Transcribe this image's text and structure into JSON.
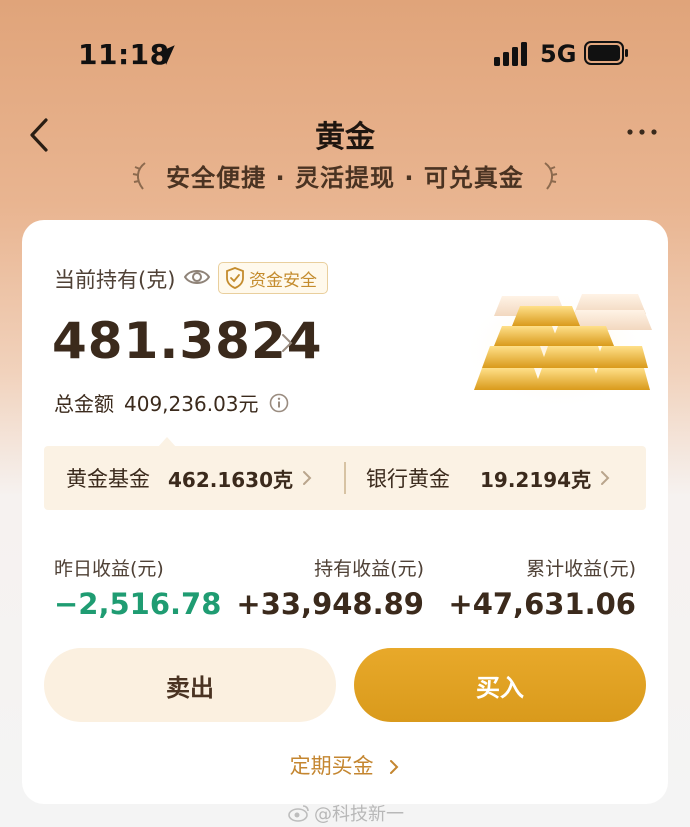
{
  "status_bar": {
    "time": "11:18",
    "network": "5G"
  },
  "header": {
    "title": "黄金",
    "slogan": "安全便捷 · 灵活提现 · 可兑真金"
  },
  "card": {
    "holding_label": "当前持有(克)",
    "safety_badge": "资金安全",
    "holding_value": "481.3824",
    "total_label": "总金额",
    "total_value": "409,236.03元",
    "split": [
      {
        "name": "黄金基金",
        "value": "462.1630克"
      },
      {
        "name": "银行黄金",
        "value": "19.2194克"
      }
    ],
    "stats": [
      {
        "label": "昨日收益(元)",
        "value": "−2,516.78",
        "color": "#1f9c72"
      },
      {
        "label": "持有收益(元)",
        "value": "+33,948.89"
      },
      {
        "label": "累计收益(元)",
        "value": "+47,631.06"
      }
    ],
    "sell_label": "卖出",
    "buy_label": "买入",
    "periodic_label": "定期买金"
  },
  "watermark": "@科技新一",
  "icons": [
    "location-arrow-icon",
    "signal-icon",
    "battery-icon",
    "back-icon",
    "more-icon",
    "eye-icon",
    "shield-icon",
    "chevron-right-icon",
    "info-icon",
    "gold-bars-icon",
    "weibo-icon"
  ],
  "colors": {
    "accent": "#d99a1c",
    "loss": "#1f9c72",
    "text": "#3b2a1c"
  }
}
